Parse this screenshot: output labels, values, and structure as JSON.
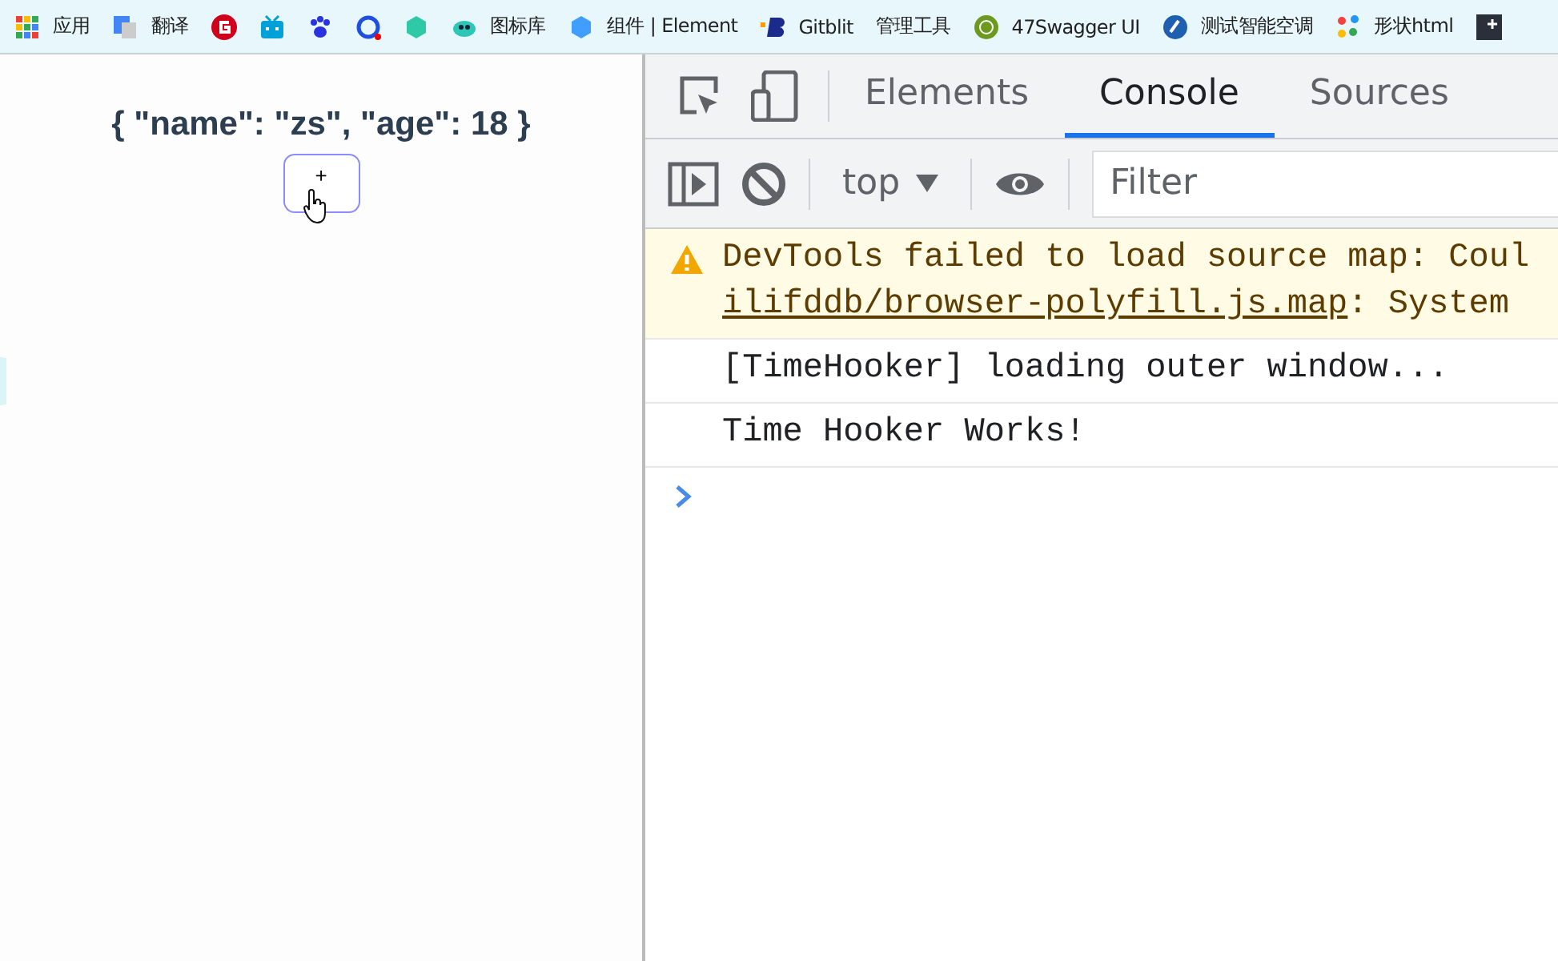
{
  "bookmarks": [
    {
      "kind": "apps",
      "label": "应用"
    },
    {
      "kind": "translate",
      "label": "翻译"
    },
    {
      "kind": "red-g"
    },
    {
      "kind": "tv"
    },
    {
      "kind": "paw"
    },
    {
      "kind": "ring"
    },
    {
      "kind": "hex-green"
    },
    {
      "kind": "fish",
      "label": "图标库"
    },
    {
      "kind": "hex-blue",
      "label": "组件 | Element"
    },
    {
      "kind": "b",
      "label": "Gitblit"
    },
    {
      "kind": "none",
      "label": "管理工具"
    },
    {
      "kind": "green-circle",
      "label": "47Swagger UI"
    },
    {
      "kind": "blue-circle",
      "label": "测试智能空调"
    },
    {
      "kind": "dots",
      "label": "形状html"
    },
    {
      "kind": "dark-square"
    }
  ],
  "page": {
    "heading": "{ \"name\": \"zs\", \"age\": 18 }",
    "button": "+"
  },
  "devtools": {
    "tabs": [
      {
        "label": "Elements",
        "selected": false
      },
      {
        "label": "Console",
        "selected": true
      },
      {
        "label": "Sources",
        "selected": false
      }
    ],
    "context": "top",
    "filter": {
      "placeholder": "Filter"
    },
    "messages": [
      {
        "kind": "warning",
        "text": "DevTools failed to load source map: Coul",
        "link": "ilifddb/browser-polyfill.js.map",
        "rest": ": System"
      },
      {
        "kind": "log",
        "text": "[TimeHooker] loading outer window..."
      },
      {
        "kind": "log",
        "text": "Time Hooker Works!"
      }
    ]
  }
}
